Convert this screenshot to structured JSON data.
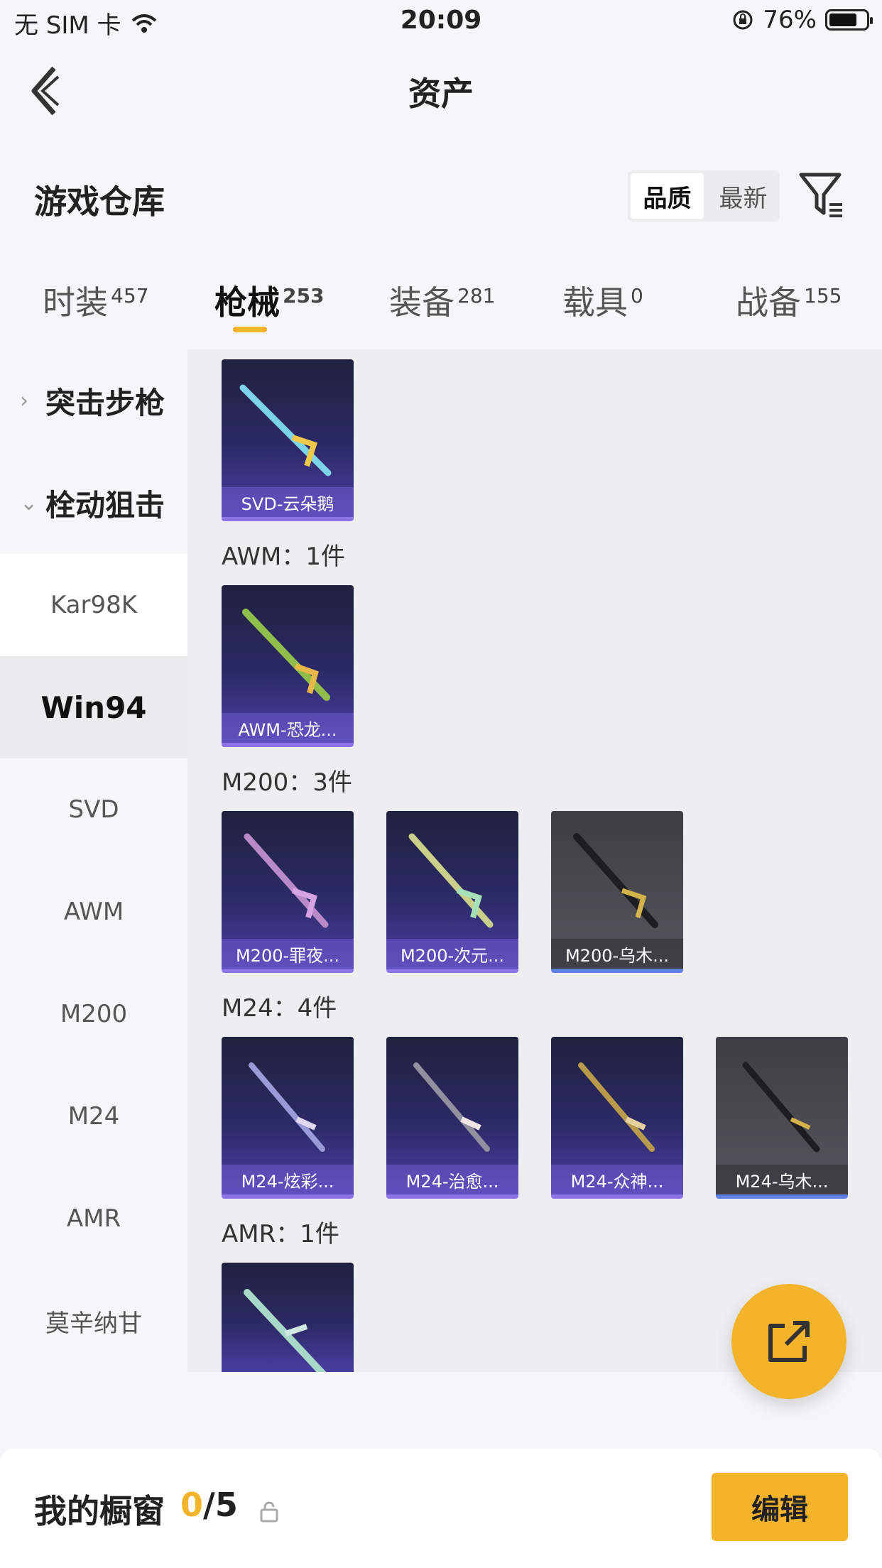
{
  "status": {
    "carrier": "无 SIM 卡",
    "time": "20:09",
    "battery": "76%",
    "battery_level": 0.76
  },
  "nav": {
    "title": "资产"
  },
  "section": {
    "title": "游戏仓库",
    "sort": [
      "品质",
      "最新"
    ],
    "sort_active": 0
  },
  "tabs": [
    {
      "label": "时装",
      "count": "457"
    },
    {
      "label": "枪械",
      "count": "253"
    },
    {
      "label": "装备",
      "count": "281"
    },
    {
      "label": "载具",
      "count": "0"
    },
    {
      "label": "战备",
      "count": "155"
    }
  ],
  "active_tab": 1,
  "sidebar": {
    "groups": [
      {
        "label": "突击步枪",
        "expanded": false
      },
      {
        "label": "栓动狙击",
        "expanded": true
      }
    ],
    "items": [
      "Kar98K",
      "Win94",
      "SVD",
      "AWM",
      "M200",
      "M24",
      "AMR",
      "莫辛纳甘"
    ],
    "selected": "Win94"
  },
  "content": {
    "svd": {
      "cards": [
        {
          "name": "SVD-云朵鹅",
          "style": "purple"
        }
      ]
    },
    "awm": {
      "label": "AWM：1件",
      "cards": [
        {
          "name": "AWM-恐龙...",
          "style": "purple"
        }
      ]
    },
    "m200": {
      "label": "M200：3件",
      "cards": [
        {
          "name": "M200-罪夜...",
          "style": "purple"
        },
        {
          "name": "M200-次元...",
          "style": "purple"
        },
        {
          "name": "M200-乌木...",
          "style": "gray"
        }
      ]
    },
    "m24": {
      "label": "M24：4件",
      "cards": [
        {
          "name": "M24-炫彩...",
          "style": "purple"
        },
        {
          "name": "M24-治愈...",
          "style": "purple"
        },
        {
          "name": "M24-众神...",
          "style": "purple"
        },
        {
          "name": "M24-乌木...",
          "style": "gray"
        }
      ]
    },
    "amr": {
      "label": "AMR：1件"
    }
  },
  "bottom": {
    "title": "我的橱窗",
    "count_current": "0",
    "count_total": "/5",
    "edit_label": "编辑"
  },
  "colors": {
    "accent": "#f3b32a",
    "card_purple": "#2c2a66",
    "card_gray": "#4a4a52"
  },
  "icons": {
    "back": "chevron-left-icon",
    "filter": "filter-icon",
    "share": "share-external-icon",
    "lock": "lock-icon"
  }
}
